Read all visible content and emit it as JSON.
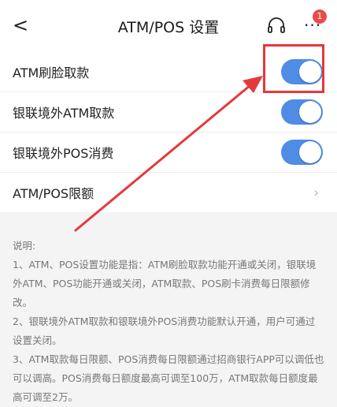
{
  "header": {
    "title": "ATM/POS 设置",
    "back_glyph": "<",
    "more_glyph": "···",
    "badge_count": "1",
    "support_icon": "headset-icon",
    "more_icon": "more-icon"
  },
  "rows": [
    {
      "label": "ATM刷脸取款",
      "control": "toggle",
      "on": true
    },
    {
      "label": "银联境外ATM取款",
      "control": "toggle",
      "on": true
    },
    {
      "label": "银联境外POS消费",
      "control": "toggle",
      "on": true
    },
    {
      "label": "ATM/POS限额",
      "control": "chevron"
    }
  ],
  "chevron_glyph": "›",
  "colors": {
    "toggle_on": "#4f8ce6",
    "highlight": "#e4393c",
    "badge": "#e94b4b"
  },
  "notes": {
    "heading": "说明:",
    "lines": [
      "1、ATM、POS设置功能是指：ATM刷脸取款功能开通或关闭，银联境外ATM、POS功能开通或关闭，ATM取款、POS刷卡消费每日限额修改。",
      "2、银联境外ATM取款和银联境外POS消费功能默认开通，用户可通过设置关闭。",
      "3、ATM取款每日限额、POS消费每日限额通过招商银行APP可以调低也可以调高。POS消费每日额度最高可调至100万，ATM取款每日额度最高可调至2万。"
    ]
  }
}
